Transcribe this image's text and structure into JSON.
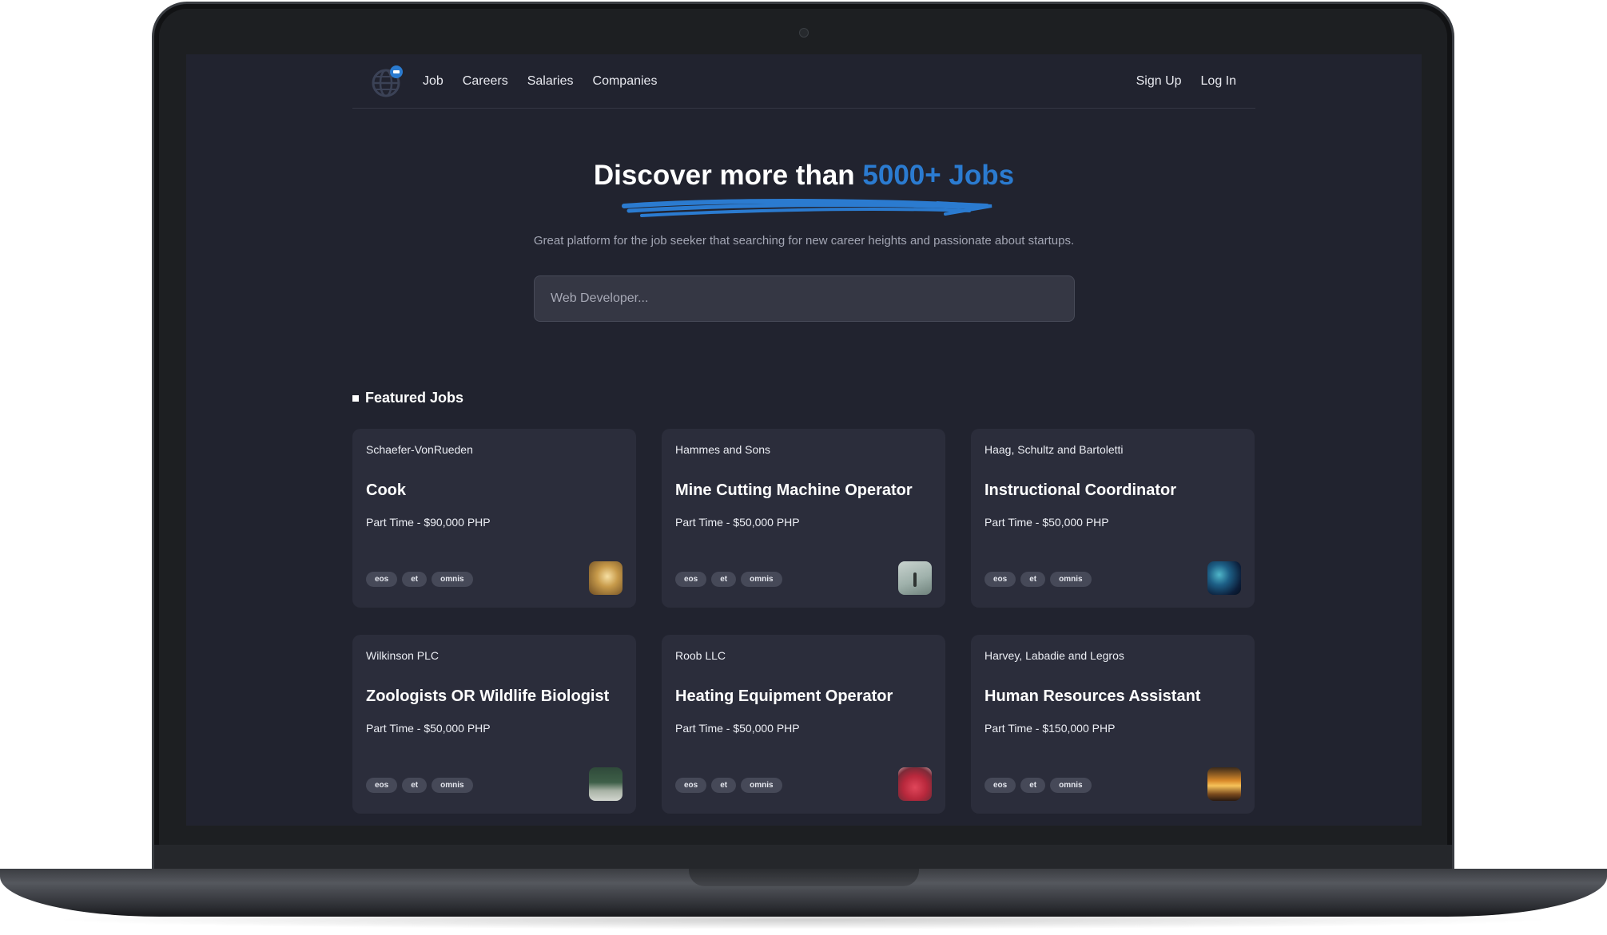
{
  "nav": {
    "links": [
      {
        "label": "Job"
      },
      {
        "label": "Careers"
      },
      {
        "label": "Salaries"
      },
      {
        "label": "Companies"
      }
    ],
    "signup_label": "Sign Up",
    "login_label": "Log In"
  },
  "hero": {
    "title_prefix": "Discover more than ",
    "title_accent": "5000+ Jobs",
    "subtitle": "Great platform for the job seeker that searching for new career heights and passionate about startups.",
    "search_placeholder": "Web Developer..."
  },
  "featured": {
    "heading": "Featured Jobs",
    "jobs": [
      {
        "company": "Schaefer-VonRueden",
        "title": "Cook",
        "meta": "Part Time - $90,000 PHP",
        "tags": [
          "eos",
          "et",
          "omnis"
        ],
        "thumb": "thumb-golden-light"
      },
      {
        "company": "Hammes and Sons",
        "title": "Mine Cutting Machine Operator",
        "meta": "Part Time - $50,000 PHP",
        "tags": [
          "eos",
          "et",
          "omnis"
        ],
        "thumb": "thumb-misty-figure"
      },
      {
        "company": "Haag, Schultz and Bartoletti",
        "title": "Instructional Coordinator",
        "meta": "Part Time - $50,000 PHP",
        "tags": [
          "eos",
          "et",
          "omnis"
        ],
        "thumb": "thumb-blue-abstract"
      },
      {
        "company": "Wilkinson PLC",
        "title": "Zoologists OR Wildlife Biologist",
        "meta": "Part Time - $50,000 PHP",
        "tags": [
          "eos",
          "et",
          "omnis"
        ],
        "thumb": "thumb-forest-field"
      },
      {
        "company": "Roob LLC",
        "title": "Heating Equipment Operator",
        "meta": "Part Time - $50,000 PHP",
        "tags": [
          "eos",
          "et",
          "omnis"
        ],
        "thumb": "thumb-red-flowers"
      },
      {
        "company": "Harvey, Labadie and Legros",
        "title": "Human Resources Assistant",
        "meta": "Part Time - $150,000 PHP",
        "tags": [
          "eos",
          "et",
          "omnis"
        ],
        "thumb": "thumb-sunset"
      }
    ]
  },
  "colors": {
    "background": "#21232f",
    "card": "#2b2d3b",
    "accent": "#2b7bd0"
  }
}
